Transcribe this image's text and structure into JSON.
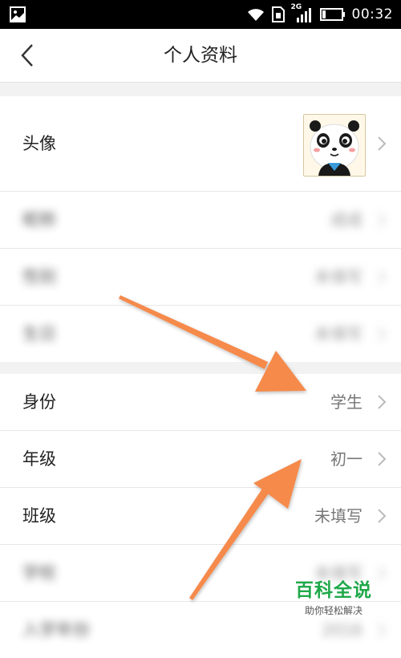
{
  "status_bar": {
    "network": "2G",
    "time": "00:32",
    "icons": [
      "image-icon",
      "wifi-icon",
      "sim-icon",
      "signal-icon",
      "battery-icon"
    ]
  },
  "header": {
    "title": "个人资料",
    "back_icon": "chevron-left-icon"
  },
  "profile": {
    "avatar": {
      "label": "头像",
      "icon": "panda-avatar-icon"
    },
    "hidden_items": [
      {
        "label": "昵称",
        "value": "成成"
      },
      {
        "label": "性别",
        "value": "未填写"
      },
      {
        "label": "生日",
        "value": "未填写"
      }
    ]
  },
  "school_info": {
    "items": [
      {
        "label": "身份",
        "value": "学生"
      },
      {
        "label": "年级",
        "value": "初一"
      },
      {
        "label": "班级",
        "value": "未填写"
      },
      {
        "label": "学校",
        "value": "未填写"
      },
      {
        "label": "入学年份",
        "value": "2016"
      }
    ]
  },
  "watermark": {
    "title": "百科全说",
    "subtitle": "助你轻松解决"
  },
  "colors": {
    "arrow": "#f58a4b",
    "watermark_green": "#1fa84a",
    "divider": "#f2f2f2"
  }
}
